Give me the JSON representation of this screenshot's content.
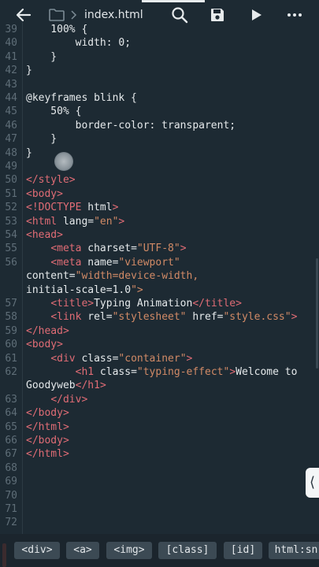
{
  "toolbar": {
    "filename": "index.html",
    "back_icon": "back-arrow-icon",
    "folder_icon": "folder-icon",
    "search_icon": "search-icon",
    "save_icon": "save-icon",
    "run_icon": "play-icon",
    "more_icon": "more-vert-icon"
  },
  "editor": {
    "lines": [
      {
        "n": "39",
        "t": "    100% {"
      },
      {
        "n": "40",
        "t": "        width: 0;"
      },
      {
        "n": "41",
        "t": "    }"
      },
      {
        "n": "42",
        "t": "}"
      },
      {
        "n": "43",
        "t": ""
      },
      {
        "n": "44",
        "t": "@keyframes blink {"
      },
      {
        "n": "45",
        "t": "    50% {"
      },
      {
        "n": "46",
        "t": "        border-color: transparent;"
      },
      {
        "n": "47",
        "t": "    }"
      },
      {
        "n": "48",
        "t": "}"
      },
      {
        "n": "49",
        "t": ""
      },
      {
        "n": "50",
        "t": "</style>"
      },
      {
        "n": "51",
        "t": "<body>"
      },
      {
        "n": "52",
        "t": "<!DOCTYPE html>"
      },
      {
        "n": "53",
        "t": "<html lang=\"en\">"
      },
      {
        "n": "54",
        "t": "<head>"
      },
      {
        "n": "55",
        "t": "    <meta charset=\"UTF-8\">"
      },
      {
        "n": "56",
        "t": "    <meta name=\"viewport\""
      },
      {
        "n": "",
        "t": "content=\"width=device-width,"
      },
      {
        "n": "",
        "t": "initial-scale=1.0\">"
      },
      {
        "n": "57",
        "t": "    <title>Typing Animation</title>"
      },
      {
        "n": "58",
        "t": "    <link rel=\"stylesheet\" href=\"style.css\">"
      },
      {
        "n": "59",
        "t": "</head>"
      },
      {
        "n": "60",
        "t": "<body>"
      },
      {
        "n": "61",
        "t": "    <div class=\"container\">"
      },
      {
        "n": "62",
        "t": "        <h1 class=\"typing-effect\">Welcome to"
      },
      {
        "n": "",
        "t": "Goodyweb</h1>"
      },
      {
        "n": "63",
        "t": "    </div>"
      },
      {
        "n": "64",
        "t": "</body>"
      },
      {
        "n": "65",
        "t": "</html>"
      },
      {
        "n": "66",
        "t": "</body>"
      },
      {
        "n": "67",
        "t": "</html>"
      },
      {
        "n": "68",
        "t": ""
      },
      {
        "n": "69",
        "t": ""
      },
      {
        "n": "70",
        "t": ""
      },
      {
        "n": "71",
        "t": ""
      },
      {
        "n": "72",
        "t": ""
      }
    ]
  },
  "snippets": [
    "<div>",
    "<a>",
    "<img>",
    "[class]",
    "[id]",
    "html:sn"
  ],
  "side_handle": "⟨",
  "colors": {
    "background": "#1d2a33",
    "tag": "#e06c75",
    "string": "#d18a66",
    "text": "#e5e9eb",
    "line_number": "#5f6e78",
    "snippet_bg": "#3c4a54"
  }
}
